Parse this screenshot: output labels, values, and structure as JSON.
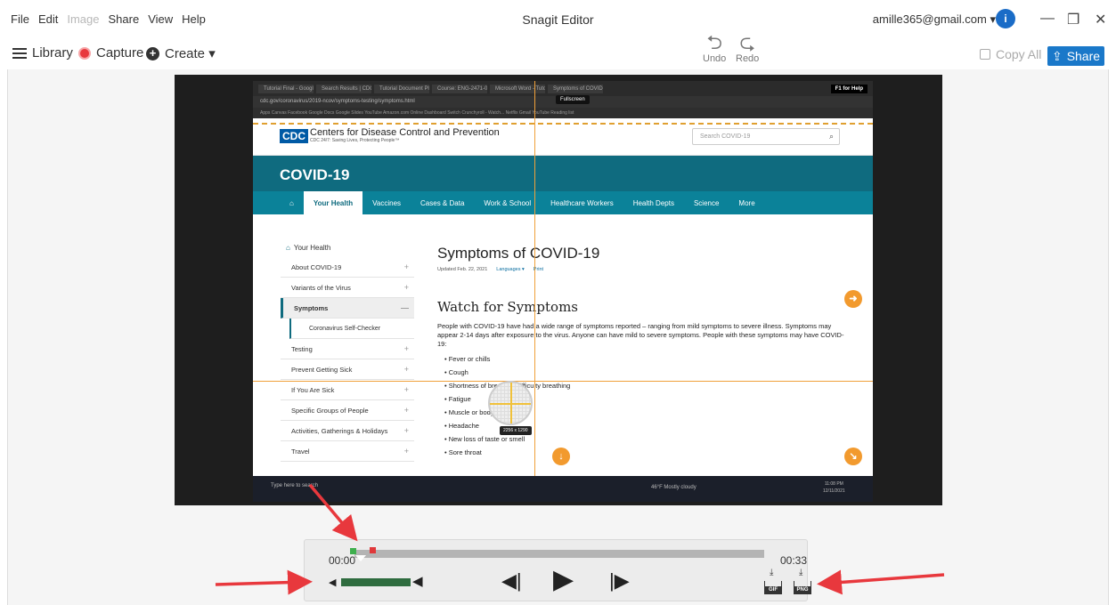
{
  "menu": [
    "File",
    "Edit",
    "Image",
    "Share",
    "View",
    "Help"
  ],
  "app_title": "Snagit Editor",
  "account": "amille365@gmail.com ▾",
  "avatar_letter": "i",
  "window": {
    "minimize": "—",
    "restore": "❐",
    "close": "✕"
  },
  "toolbar": {
    "library": "Library",
    "capture": "Capture",
    "create": "Create ▾",
    "undo": "Undo",
    "redo": "Redo",
    "copy_all": "Copy All",
    "share": "Share"
  },
  "browser": {
    "tabs": [
      "Tutorial Final - Google D...",
      "Search Results | CDC",
      "Tutorial Document Plan",
      "Course: ENG-2471-01 Wr...",
      "Microsoft Word - Tutoria...",
      "Symptoms of COVID-19 |"
    ],
    "help_badge": "F1 for Help",
    "fullscreen_tag": "Fullscreen",
    "address": "cdc.gov/coronavirus/2019-ncov/symptoms-testing/symptoms.html",
    "bookmarks": "Apps   Canvas   Facebook   Google Docs   Google Slides   YouTube   Amazon.com Online   Dashboard   Switch   Crunchyroll - Watch...   Netflix   Gmail   YouTube   Reading list"
  },
  "cdc": {
    "logo": "CDC",
    "org_name": "Centers for Disease Control and Prevention",
    "tagline": "CDC 24/7: Saving Lives, Protecting People™",
    "search_placeholder": "Search COVID-19",
    "band_title": "COVID-19",
    "nav": [
      "Your Health",
      "Vaccines",
      "Cases & Data",
      "Work & School",
      "Healthcare Workers",
      "Health Depts",
      "Science",
      "More"
    ],
    "sidebar_head": "Your Health",
    "sidebar": [
      {
        "label": "About COVID-19",
        "mark": "+"
      },
      {
        "label": "Variants of the Virus",
        "mark": "+"
      },
      {
        "label": "Symptoms",
        "mark": "—"
      },
      {
        "label": "Coronavirus Self-Checker",
        "mark": ""
      },
      {
        "label": "Testing",
        "mark": "+"
      },
      {
        "label": "Prevent Getting Sick",
        "mark": "+"
      },
      {
        "label": "If You Are Sick",
        "mark": "+"
      },
      {
        "label": "Specific Groups of People",
        "mark": "+"
      },
      {
        "label": "Activities, Gatherings & Holidays",
        "mark": "+"
      },
      {
        "label": "Travel",
        "mark": "+"
      }
    ],
    "page_title": "Symptoms of COVID-19",
    "updated": "Updated Feb. 22, 2021",
    "languages": "Languages ▾",
    "print": "Print",
    "h2": "Watch for Symptoms",
    "para": "People with COVID-19 have had a wide range of symptoms reported – ranging from mild symptoms to severe illness. Symptoms may appear 2-14 days after exposure to the virus. Anyone can have mild to severe symptoms. People with these symptoms may have COVID-19:",
    "symptoms": [
      "Fever or chills",
      "Cough",
      "Shortness of breath or difficulty breathing",
      "Fatigue",
      "Muscle or body aches",
      "Headache",
      "New loss of taste or smell",
      "Sore throat"
    ]
  },
  "capture_overlay": {
    "dimensions": "2256 x 1290"
  },
  "taskbar": {
    "search": "Type here to search",
    "weather": "46°F  Mostly cloudy",
    "time": "11:08 PM",
    "date": "12/11/2021"
  },
  "player": {
    "time_current": "00:00",
    "time_total": "00:33",
    "progress_fraction": 0,
    "volume_fraction": 1.0,
    "gif_label": "GIF",
    "png_label": "PNG"
  },
  "colors": {
    "accent": "#1a78c9",
    "annotation_arrow": "#e8383d",
    "cdc_teal": "#0f6b7f"
  }
}
